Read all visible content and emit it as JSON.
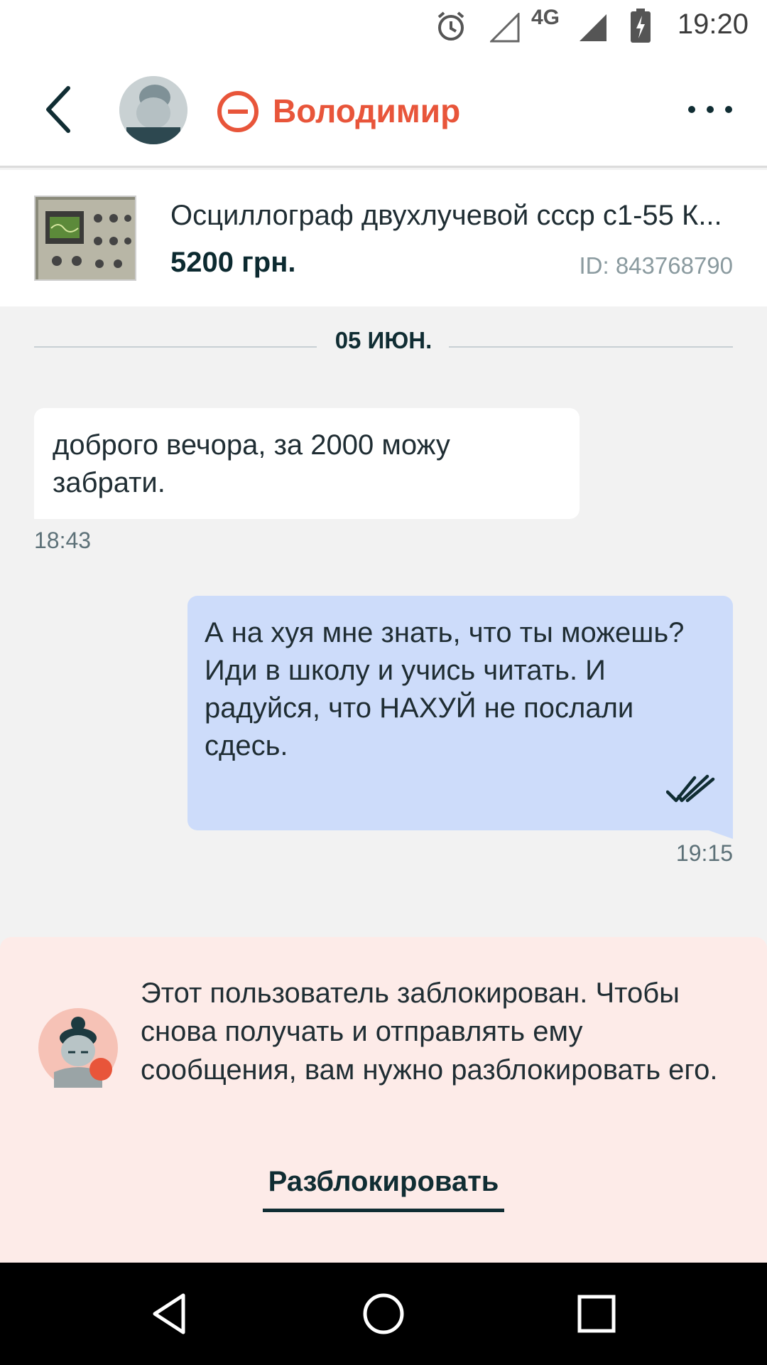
{
  "status_bar": {
    "time": "19:20",
    "network": "4G",
    "icons": [
      "alarm-icon",
      "signal-empty-icon",
      "signal-icon",
      "battery-charging-icon"
    ]
  },
  "header": {
    "contact_name": "Володимир",
    "back_icon": "chevron-left-icon",
    "blocked_icon": "blocked-minus-circle-icon",
    "menu_icon": "more-horizontal-icon"
  },
  "listing": {
    "title": "Осциллограф двухлучевой ссср с1-55 К...",
    "price": "5200 грн.",
    "id": "ID: 843768790"
  },
  "date_separator": "05 ИЮН.",
  "messages": [
    {
      "direction": "in",
      "text": "доброго вечора, за 2000 можу забрати.",
      "time": "18:43"
    },
    {
      "direction": "out",
      "text": "А на хуя мне знать, что ты можешь? Иди в школу и учись читать. И радуйся, что НАХУЙ не послали сдесь.",
      "time": "19:15",
      "status": "read"
    }
  ],
  "blocked_notice": {
    "text": "Этот пользователь заблокирован. Чтобы снова получать и отправлять ему сообщения, вам нужно разблокировать его.",
    "button": "Разблокировать"
  },
  "colors": {
    "accent": "#e8553a",
    "outgoing_bubble": "#cddcfa",
    "blocked_panel": "#fdebe8",
    "text_dark": "#102d33"
  },
  "nav_bar": {
    "icons": [
      "back-triangle-icon",
      "home-circle-icon",
      "recents-square-icon"
    ]
  }
}
